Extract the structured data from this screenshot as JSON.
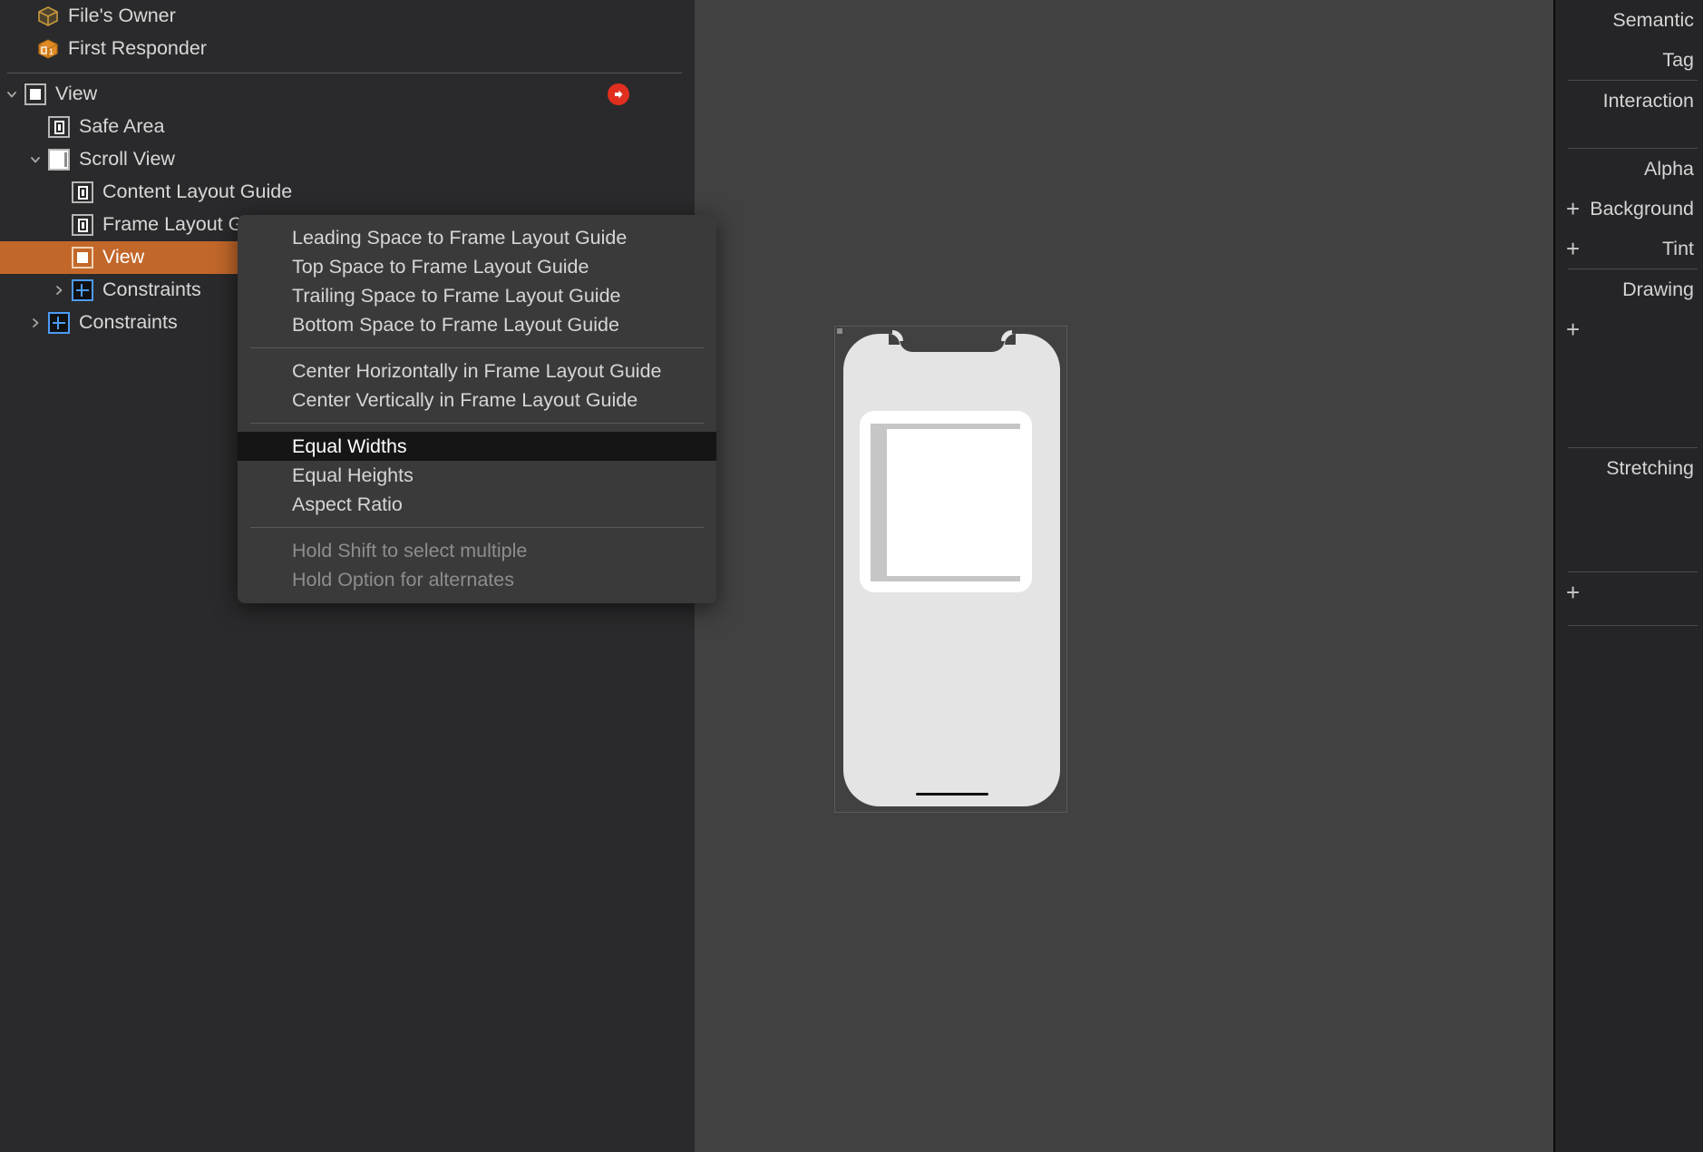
{
  "outline": {
    "top_items": [
      {
        "label": "File's Owner",
        "icon": "cube-icon"
      },
      {
        "label": "First Responder",
        "icon": "cube-first-responder-icon"
      }
    ],
    "tree": [
      {
        "label": "View",
        "icon": "view-placeholder-icon",
        "indent": 0,
        "disclosure": "down",
        "selected": false,
        "badge": "red-arrow-icon"
      },
      {
        "label": "Safe Area",
        "icon": "layout-guide-icon",
        "indent": 1,
        "disclosure": "none",
        "selected": false
      },
      {
        "label": "Scroll View",
        "icon": "scroll-view-icon",
        "indent": 1,
        "disclosure": "down",
        "selected": false
      },
      {
        "label": "Content Layout Guide",
        "icon": "layout-guide-icon",
        "indent": 2,
        "disclosure": "none",
        "selected": false
      },
      {
        "label": "Frame Layout Guide",
        "icon": "layout-guide-icon",
        "indent": 2,
        "disclosure": "none",
        "selected": false
      },
      {
        "label": "View",
        "icon": "view-placeholder-icon",
        "indent": 2,
        "disclosure": "none",
        "selected": true
      },
      {
        "label": "Constraints",
        "icon": "constraints-icon",
        "indent": 2,
        "disclosure": "right",
        "selected": false
      },
      {
        "label": "Constraints",
        "icon": "constraints-icon",
        "indent": 1,
        "disclosure": "right",
        "selected": false
      }
    ]
  },
  "context_menu": {
    "groups": [
      {
        "items": [
          {
            "label": "Leading Space to Frame Layout Guide",
            "state": "normal"
          },
          {
            "label": "Top Space to Frame Layout Guide",
            "state": "normal"
          },
          {
            "label": "Trailing Space to Frame Layout Guide",
            "state": "normal"
          },
          {
            "label": "Bottom Space to Frame Layout Guide",
            "state": "normal"
          }
        ]
      },
      {
        "items": [
          {
            "label": "Center Horizontally in Frame Layout Guide",
            "state": "normal"
          },
          {
            "label": "Center Vertically in Frame Layout Guide",
            "state": "normal"
          }
        ]
      },
      {
        "items": [
          {
            "label": "Equal Widths",
            "state": "highlighted"
          },
          {
            "label": "Equal Heights",
            "state": "normal"
          },
          {
            "label": "Aspect Ratio",
            "state": "normal"
          }
        ]
      },
      {
        "items": [
          {
            "label": "Hold Shift to select multiple",
            "state": "hint"
          },
          {
            "label": "Hold Option for alternates",
            "state": "hint"
          }
        ]
      }
    ]
  },
  "inspector": {
    "rows": [
      {
        "label": "Semantic",
        "plus": false
      },
      {
        "label": "Tag",
        "plus": false
      },
      {
        "separator": true
      },
      {
        "label": "Interaction",
        "plus": false
      },
      {
        "spacer": "md"
      },
      {
        "separator": true
      },
      {
        "label": "Alpha",
        "plus": false
      },
      {
        "label": "Background",
        "plus": true
      },
      {
        "label": "Tint",
        "plus": true
      },
      {
        "separator": true
      },
      {
        "label": "Drawing",
        "plus": false
      },
      {
        "label": "",
        "plus": true
      },
      {
        "spacer": "xl"
      },
      {
        "separator": true
      },
      {
        "label": "Stretching",
        "plus": false
      },
      {
        "spacer": "lg"
      },
      {
        "separator": true
      },
      {
        "label": "",
        "plus": true
      },
      {
        "spacer": "sm"
      },
      {
        "separator": true
      }
    ]
  },
  "colors": {
    "panel_bg": "#2a2a2c",
    "canvas_bg": "#414141",
    "inspector_bg": "#252528",
    "selection": "#c2672a",
    "menu_bg": "#3a3a3a",
    "menu_highlight": "#151515",
    "badge_red": "#e02f1f",
    "constraint_blue": "#4d9bf5",
    "cube_gold": "#c99a3d",
    "cube_orange": "#e08a25"
  }
}
